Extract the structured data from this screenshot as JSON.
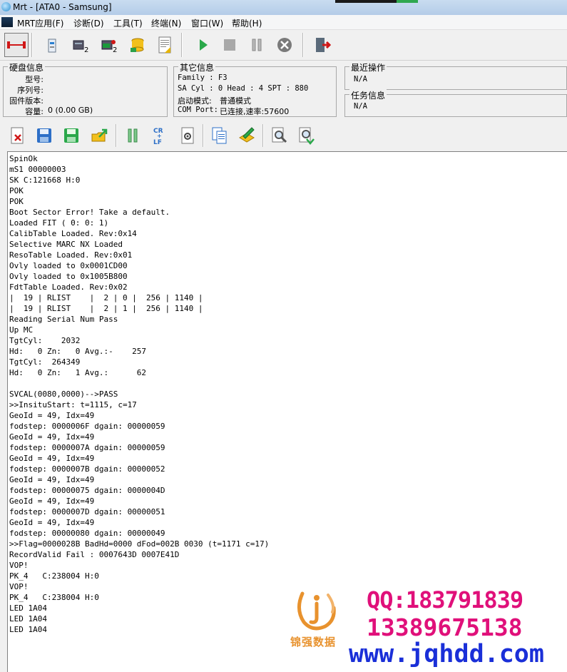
{
  "window": {
    "title": "Mrt - [ATA0 - Samsung]"
  },
  "menubar": {
    "items": [
      {
        "label": "MRT应用(F)"
      },
      {
        "label": "诊断(D)"
      },
      {
        "label": "工具(T)"
      },
      {
        "label": "终端(N)"
      },
      {
        "label": "窗口(W)"
      },
      {
        "label": "帮助(H)"
      }
    ]
  },
  "toolbar_main": {
    "icons": [
      "connect-icon",
      "drive-tool-icon",
      "drive-info-icon",
      "drive-test-icon",
      "database-icon",
      "report-icon",
      "play-icon",
      "stop-icon",
      "pause-icon",
      "cancel-icon",
      "exit-icon"
    ]
  },
  "disk_info": {
    "title": "硬盘信息",
    "model_label": "型号:",
    "serial_label": "序列号:",
    "firmware_label": "固件版本:",
    "capacity_label": "容量:",
    "capacity_value": "0 (0.00 GB)"
  },
  "other_info": {
    "title": "其它信息",
    "family": "Family  : F3",
    "geometry": "SA Cyl  : 0  Head : 4  SPT : 880",
    "boot_mode_label": "启动模式:",
    "boot_mode_value": "普通模式",
    "com_port_label": "COM Port:",
    "com_port_value": "已连接,速率:57600"
  },
  "recent_ops": {
    "title": "最近操作",
    "value": "N/A"
  },
  "task_info": {
    "title": "任务信息",
    "value": "N/A"
  },
  "toolbar_log": {
    "icons": [
      "clear-log-icon",
      "save-icon",
      "save-as-icon",
      "export-icon",
      "pause-log-icon",
      "crlf-icon",
      "settings-icon",
      "copy-icon",
      "edit-icon",
      "find-icon",
      "find-next-icon"
    ]
  },
  "log": {
    "lines": [
      "SpinOk",
      "mS1 00000003",
      "SK C:121668 H:0",
      "POK",
      "POK",
      "Boot Sector Error! Take a default.",
      "Loaded FIT ( 0: 0: 1)",
      "CalibTable Loaded. Rev:0x14",
      "Selective MARC NX Loaded",
      "ResoTable Loaded. Rev:0x01",
      "Ovly loaded to 0x0001CD00",
      "Ovly loaded to 0x1005B800",
      "FdtTable Loaded. Rev:0x02",
      "|  19 | RLIST    |  2 | 0 |  256 | 1140 |",
      "|  19 | RLIST    |  2 | 1 |  256 | 1140 |",
      "Reading Serial Num Pass",
      "Up MC",
      "TgtCyl:    2032",
      "Hd:   0 Zn:   0 Avg.:-    257",
      "TgtCyl:  264349",
      "Hd:   0 Zn:   1 Avg.:      62",
      "",
      "SVCAL(0080,0000)-->PASS",
      ">>InsituStart: t=1115, c=17",
      "GeoId = 49, Idx=49",
      "fodstep: 0000006F dgain: 00000059",
      "GeoId = 49, Idx=49",
      "fodstep: 0000007A dgain: 00000059",
      "GeoId = 49, Idx=49",
      "fodstep: 0000007B dgain: 00000052",
      "GeoId = 49, Idx=49",
      "fodstep: 00000075 dgain: 0000004D",
      "GeoId = 49, Idx=49",
      "fodstep: 0000007D dgain: 00000051",
      "GeoId = 49, Idx=49",
      "fodstep: 00000080 dgain: 00000049",
      ">>Flag=0000028B BadHd=0000 dFod=002B 0030 (t=1171 c=17)",
      "RecordValid Fail : 0007643D 0007E41D",
      "VOP!",
      "PK_4   C:238004 H:0",
      "VOP!",
      "PK_4   C:238004 H:0",
      "LED 1A04",
      "LED 1A04",
      "LED 1A04"
    ]
  },
  "watermark": {
    "logo_text": "锦强数据",
    "qq": "QQ:183791839",
    "phone": "13389675138",
    "url": "www.jqhdd.com"
  },
  "colors": {
    "watermark_pink": "#e0107a",
    "watermark_blue": "#1a2fd8",
    "logo_orange": "#e8922e"
  }
}
